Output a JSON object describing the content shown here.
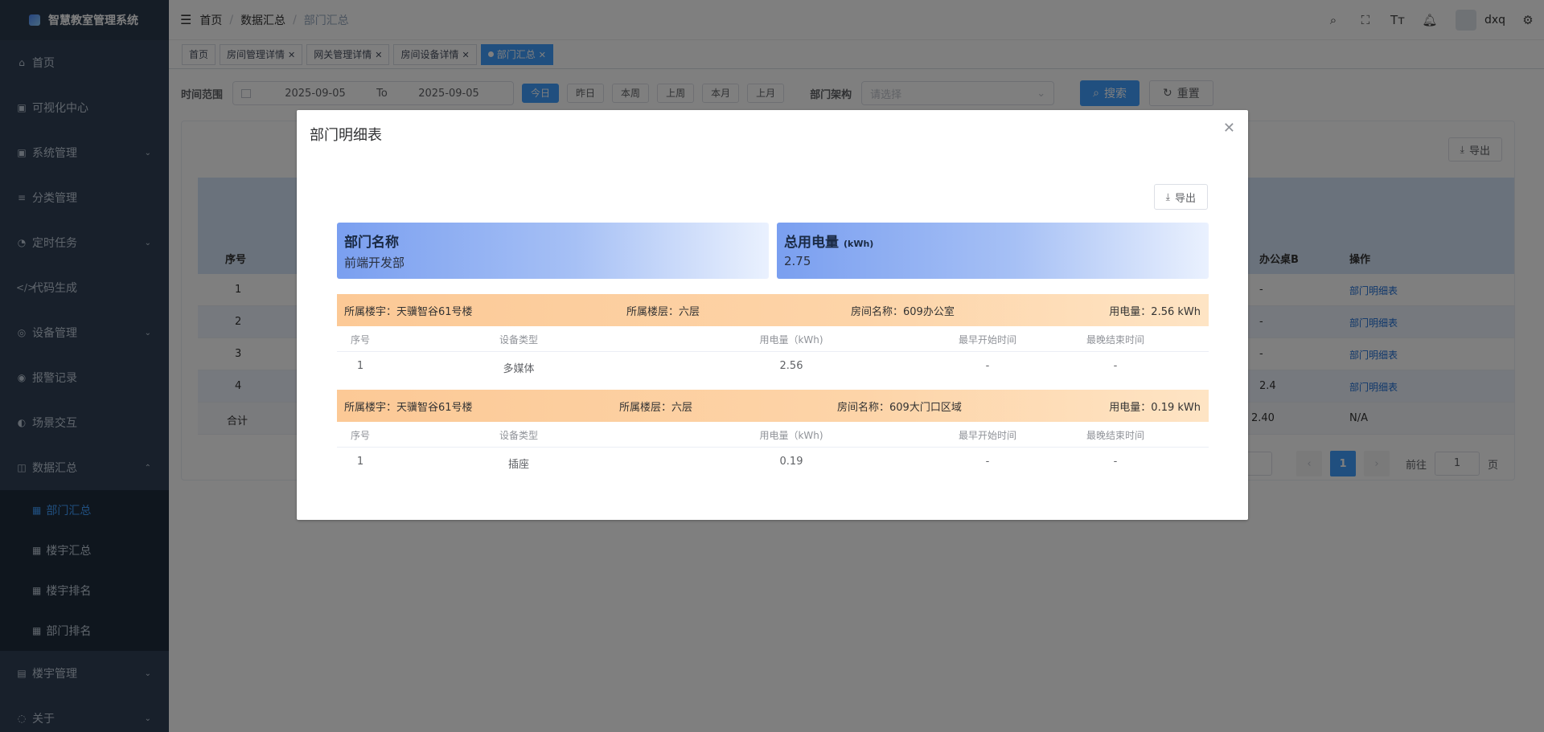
{
  "app": {
    "title": "智慧教室管理系统"
  },
  "sidebar": {
    "items": [
      {
        "label": "首页",
        "icon": "home-icon",
        "glyph": "⌂"
      },
      {
        "label": "可视化中心",
        "icon": "chart-icon",
        "glyph": "▣"
      },
      {
        "label": "系统管理",
        "icon": "system-icon",
        "glyph": "▣",
        "expandable": true
      },
      {
        "label": "分类管理",
        "icon": "list-icon",
        "glyph": "≡"
      },
      {
        "label": "定时任务",
        "icon": "timer-icon",
        "glyph": "◔",
        "expandable": true
      },
      {
        "label": "代码生成",
        "icon": "code-icon",
        "glyph": "</>"
      },
      {
        "label": "设备管理",
        "icon": "device-icon",
        "glyph": "◎",
        "expandable": true
      },
      {
        "label": "报警记录",
        "icon": "alarm-icon",
        "glyph": "◉"
      },
      {
        "label": "场景交互",
        "icon": "scene-icon",
        "glyph": "◐"
      },
      {
        "label": "数据汇总",
        "icon": "database-icon",
        "glyph": "◫",
        "expanded": true
      },
      {
        "label": "部门汇总",
        "icon": "grid-icon",
        "glyph": "▦",
        "sub": true,
        "active": true
      },
      {
        "label": "楼宇汇总",
        "icon": "grid-icon",
        "glyph": "▦",
        "sub": true
      },
      {
        "label": "楼宇排名",
        "icon": "grid-icon",
        "glyph": "▦",
        "sub": true
      },
      {
        "label": "部门排名",
        "icon": "grid-icon",
        "glyph": "▦",
        "sub": true
      },
      {
        "label": "楼宇管理",
        "icon": "building-icon",
        "glyph": "▤",
        "expandable": true
      },
      {
        "label": "关于",
        "icon": "about-icon",
        "glyph": "◌",
        "expandable": true
      }
    ]
  },
  "header": {
    "breadcrumb": [
      "首页",
      "数据汇总",
      "部门汇总"
    ],
    "username": "dxq"
  },
  "tags": [
    {
      "label": "首页",
      "closable": false
    },
    {
      "label": "房间管理详情",
      "closable": true
    },
    {
      "label": "网关管理详情",
      "closable": true
    },
    {
      "label": "房间设备详情",
      "closable": true
    },
    {
      "label": "部门汇总",
      "closable": true,
      "active": true
    }
  ],
  "filters": {
    "time_label": "时间范围",
    "start_date": "2025-09-05",
    "to_label": "To",
    "end_date": "2025-09-05",
    "quick": [
      "今日",
      "昨日",
      "本周",
      "上周",
      "本月",
      "上月"
    ],
    "dept_label": "部门架构",
    "dept_placeholder": "请选择",
    "search_label": "搜索",
    "reset_label": "重置"
  },
  "background_table": {
    "export_label": "导出",
    "header_index": "序号",
    "header_partial": "办公桌B",
    "header_action": "操作",
    "rows": [
      {
        "index": "1",
        "val": "-",
        "action": "部门明细表"
      },
      {
        "index": "2",
        "val": "-",
        "action": "部门明细表"
      },
      {
        "index": "3",
        "val": "-",
        "action": "部门明细表"
      },
      {
        "index": "4",
        "val": "2.4",
        "action": "部门明细表"
      }
    ],
    "total": {
      "label": "合计",
      "val": "2.40",
      "action": "N/A"
    },
    "pager": {
      "current": "1",
      "goto_label": "前往",
      "goto_value": "1",
      "page_suffix": "页"
    }
  },
  "dialog": {
    "title": "部门明细表",
    "export_label": "导出",
    "dept_title": "部门名称",
    "dept_value": "前端开发部",
    "power_title": "总用电量",
    "power_unit": "(kWh)",
    "power_value": "2.75",
    "columns": [
      "序号",
      "设备类型",
      "用电量（kWh)",
      "最早开始时间",
      "最晚结束时间"
    ],
    "rooms": [
      {
        "building": "所属楼宇：天骥智谷61号楼",
        "floor": "所属楼层：六层",
        "room": "房间名称：609办公室",
        "usage": "用电量：2.56 kWh",
        "rows": [
          [
            "1",
            "多媒体",
            "2.56",
            "-",
            "-"
          ]
        ]
      },
      {
        "building": "所属楼宇：天骥智谷61号楼",
        "floor": "所属楼层：六层",
        "room": "房间名称：609大门口区域",
        "usage": "用电量：0.19 kWh",
        "rows": [
          [
            "1",
            "插座",
            "0.19",
            "-",
            "-"
          ]
        ]
      }
    ]
  }
}
